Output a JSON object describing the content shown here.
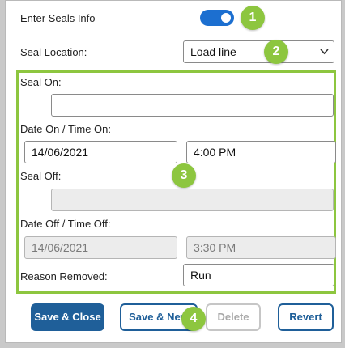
{
  "form": {
    "enter_seals_label": "Enter Seals Info",
    "enter_seals_enabled": true,
    "seal_location_label": "Seal Location:",
    "seal_location_value": "Load line",
    "seal_on_label": "Seal On:",
    "seal_on_value": "",
    "date_on_label": "Date On / Time On:",
    "date_on_value": "14/06/2021",
    "time_on_value": "4:00 PM",
    "seal_off_label": "Seal Off:",
    "seal_off_value": "",
    "date_off_label": "Date Off / Time Off:",
    "date_off_value": "14/06/2021",
    "time_off_value": "3:30 PM",
    "reason_removed_label": "Reason Removed:",
    "reason_removed_value": "Run"
  },
  "buttons": {
    "save_close": "Save & Close",
    "save_new": "Save & New",
    "delete": "Delete",
    "revert": "Revert"
  },
  "callouts": [
    "1",
    "2",
    "3",
    "4"
  ],
  "colors": {
    "toggle_on": "#1c6fd0",
    "primary": "#1f5f99",
    "callout": "#8dc63f"
  },
  "icons": {
    "select_arrow": "chevron-down-icon"
  }
}
